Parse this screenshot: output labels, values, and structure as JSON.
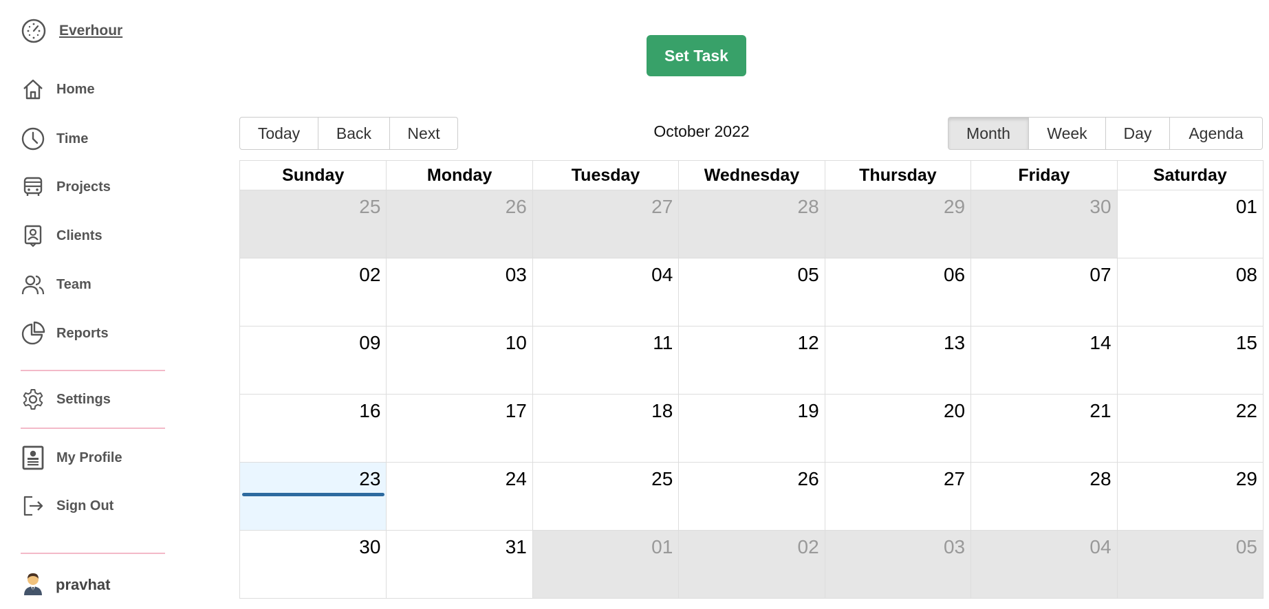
{
  "sidebar": {
    "brand": "Everhour",
    "items": [
      {
        "label": "Home",
        "icon": "home-icon"
      },
      {
        "label": "Time",
        "icon": "clock-icon"
      },
      {
        "label": "Projects",
        "icon": "bus-icon"
      },
      {
        "label": "Clients",
        "icon": "client-badge-icon"
      },
      {
        "label": "Team",
        "icon": "team-icon"
      },
      {
        "label": "Reports",
        "icon": "pie-chart-icon"
      },
      {
        "label": "Settings",
        "icon": "gear-icon"
      },
      {
        "label": "My Profile",
        "icon": "profile-card-icon"
      },
      {
        "label": "Sign Out",
        "icon": "sign-out-icon"
      }
    ],
    "user": "pravhat"
  },
  "set_task_label": "Set Task",
  "toolbar": {
    "today": "Today",
    "back": "Back",
    "next": "Next",
    "title": "October 2022",
    "views": [
      "Month",
      "Week",
      "Day",
      "Agenda"
    ],
    "active_view": "Month"
  },
  "calendar": {
    "weekdays": [
      "Sunday",
      "Monday",
      "Tuesday",
      "Wednesday",
      "Thursday",
      "Friday",
      "Saturday"
    ],
    "weeks": [
      [
        "25",
        "26",
        "27",
        "28",
        "29",
        "30",
        "01"
      ],
      [
        "02",
        "03",
        "04",
        "05",
        "06",
        "07",
        "08"
      ],
      [
        "09",
        "10",
        "11",
        "12",
        "13",
        "14",
        "15"
      ],
      [
        "16",
        "17",
        "18",
        "19",
        "20",
        "21",
        "22"
      ],
      [
        "23",
        "24",
        "25",
        "26",
        "27",
        "28",
        "29"
      ],
      [
        "30",
        "31",
        "01",
        "02",
        "03",
        "04",
        "05"
      ]
    ],
    "today": "23"
  },
  "colors": {
    "accent_green": "#38a169",
    "today_bg": "#eaf6ff",
    "event_bar": "#2d6a9f",
    "divider": "#f3b9c8",
    "off_range_bg": "#e6e6e6"
  }
}
